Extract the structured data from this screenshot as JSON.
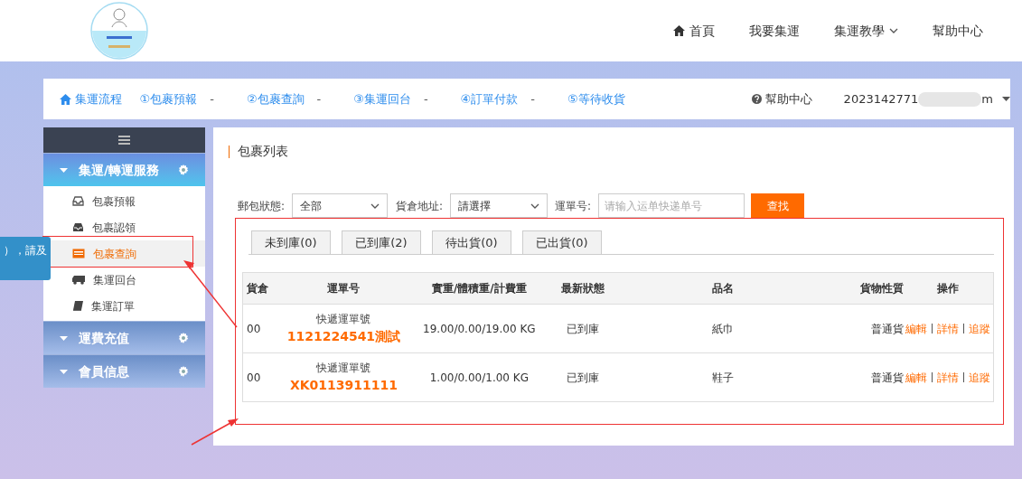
{
  "header": {
    "nav": [
      {
        "label": "首頁"
      },
      {
        "label": "我要集運"
      },
      {
        "label": "集運教學"
      },
      {
        "label": "幫助中心"
      }
    ]
  },
  "steps_bar": {
    "steps": [
      {
        "label": "集運流程"
      },
      {
        "label": "①包裹預報"
      },
      {
        "label": "②包裹查詢"
      },
      {
        "label": "③集運回台"
      },
      {
        "label": "④訂單付款"
      },
      {
        "label": "⑤等待收貨"
      }
    ],
    "separator": "-",
    "help": "幫助中心",
    "account_start": "2023142771",
    "account_end": "m"
  },
  "tooltip": {
    "text": "），請及"
  },
  "sidebar": {
    "groups": [
      {
        "label": "集運/轉運服務",
        "expanded": true,
        "items": [
          {
            "label": "包裹預報",
            "selected": false
          },
          {
            "label": "包裹認領",
            "selected": false
          },
          {
            "label": "包裹查詢",
            "selected": true
          },
          {
            "label": "集運回台",
            "selected": false
          },
          {
            "label": "集運訂單",
            "selected": false
          }
        ]
      },
      {
        "label": "運費充值",
        "expanded": false
      },
      {
        "label": "會員信息",
        "expanded": false
      }
    ]
  },
  "main": {
    "title": "包裹列表",
    "filters": {
      "status_label": "郵包狀態:",
      "status_value": "全部",
      "warehouse_label": "貨倉地址:",
      "warehouse_value": "請選擇",
      "waybill_label": "運單号:",
      "waybill_placeholder": "请输入运单快递单号",
      "search_button": "查找"
    },
    "tabs": [
      {
        "label": "未到庫(0)",
        "selected": false
      },
      {
        "label": "已到庫(2)",
        "selected": false
      },
      {
        "label": "待出貨(0)",
        "selected": false
      },
      {
        "label": "已出貨(0)",
        "selected": false
      }
    ],
    "table": {
      "columns": [
        "貨倉",
        "運單号",
        "實重/體積重/計費重",
        "最新狀態",
        "品名",
        "貨物性質",
        "操作"
      ],
      "rows": [
        {
          "warehouse": "00",
          "waybill_label": "快遞運單號",
          "waybill": "1121224541測試",
          "weights": "19.00/0.00/19.00 KG",
          "status": "已到庫",
          "name": "紙巾",
          "nature": "普通貨",
          "actions": [
            "編輯",
            "詳情",
            "追蹤"
          ]
        },
        {
          "warehouse": "00",
          "waybill_label": "快遞運單號",
          "waybill": "XK0113911111",
          "weights": "1.00/0.00/1.00 KG",
          "status": "已到庫",
          "name": "鞋子",
          "nature": "普通貨",
          "actions": [
            "編輯",
            "詳情",
            "追蹤"
          ]
        }
      ]
    }
  }
}
